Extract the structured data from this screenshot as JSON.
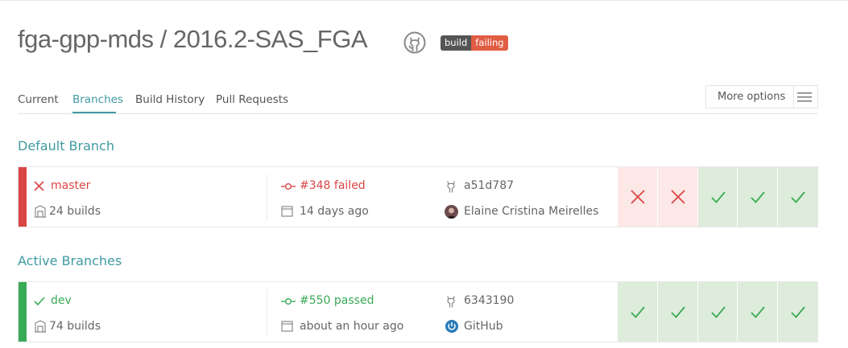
{
  "repo": {
    "title": "fga-gpp-mds / 2016.2-SAS_FGA",
    "badge_left": "build",
    "badge_right": "failing"
  },
  "tabs": [
    {
      "label": "Current"
    },
    {
      "label": "Branches"
    },
    {
      "label": "Build History"
    },
    {
      "label": "Pull Requests"
    }
  ],
  "active_tab": "Branches",
  "more_options": {
    "label": "More options"
  },
  "sections": {
    "default_title": "Default Branch",
    "active_title": "Active Branches"
  },
  "default_branch": {
    "name": "master",
    "status": "failed",
    "builds": "24 builds",
    "build_label": "#348 failed",
    "time": "14 days ago",
    "commit": "a51d787",
    "author": "Elaine Cristina Meirelles",
    "history": [
      "failed",
      "failed",
      "passed",
      "passed",
      "passed"
    ]
  },
  "active_branches": [
    {
      "name": "dev",
      "status": "passed",
      "builds": "74 builds",
      "build_label": "#550 passed",
      "time": "about an hour ago",
      "commit": "6343190",
      "author": "GitHub",
      "history": [
        "passed",
        "passed",
        "passed",
        "passed",
        "passed"
      ]
    }
  ],
  "colors": {
    "accent": "#3f9aa1",
    "failed": "#db4545",
    "passed": "#39aa56",
    "failed_bg": "#fce8e6",
    "passed_bg": "#deecdb"
  },
  "icons": {
    "repo": "github-icon",
    "branch_fail": "cross-icon",
    "branch_pass": "check-icon",
    "builds": "building-icon",
    "build_number": "commit-node-icon",
    "time": "calendar-icon",
    "commit": "github-icon",
    "more": "hamburger-icon"
  }
}
